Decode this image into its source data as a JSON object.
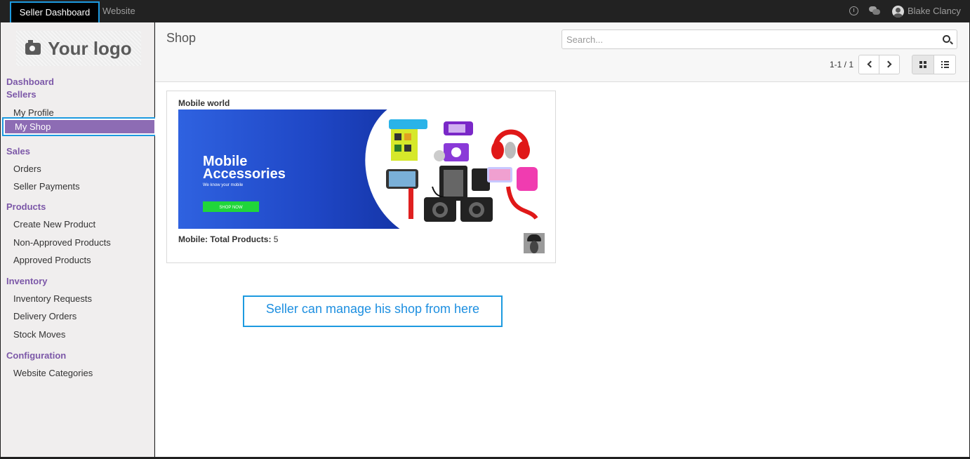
{
  "topbar": {
    "tabs": [
      "Seller Dashboard",
      "Website"
    ],
    "user_name": "Blake Clancy"
  },
  "sidebar": {
    "logo_text": "Your logo",
    "sections": [
      {
        "title": "Dashboard"
      },
      {
        "title": "Sellers",
        "items": [
          "My Profile",
          "My Shop"
        ]
      },
      {
        "title": "Sales",
        "items": [
          "Orders",
          "Seller Payments"
        ]
      },
      {
        "title": "Products",
        "items": [
          "Create New Product",
          "Non-Approved Products",
          "Approved Products"
        ]
      },
      {
        "title": "Inventory",
        "items": [
          "Inventory Requests",
          "Delivery Orders",
          "Stock Moves"
        ]
      },
      {
        "title": "Configuration",
        "items": [
          "Website Categories"
        ]
      }
    ],
    "active_item": "My Shop"
  },
  "main": {
    "title": "Shop",
    "search_placeholder": "Search...",
    "pager": "1-1 / 1",
    "card": {
      "name": "Mobile world",
      "banner_title_1": "Mobile",
      "banner_title_2": "Accessories",
      "banner_subtitle": "We know your mobile",
      "banner_button": "SHOP NOW",
      "stats_label": "Mobile: Total Products:",
      "stats_value": "5"
    },
    "callout": "Seller can manage his shop from here"
  },
  "colors": {
    "accent_purple": "#7c58a8",
    "active_item_bg": "#8d6cb4",
    "highlight_blue": "#1d9ae0",
    "banner_blue": "#2855d6",
    "banner_green": "#20d63a"
  }
}
